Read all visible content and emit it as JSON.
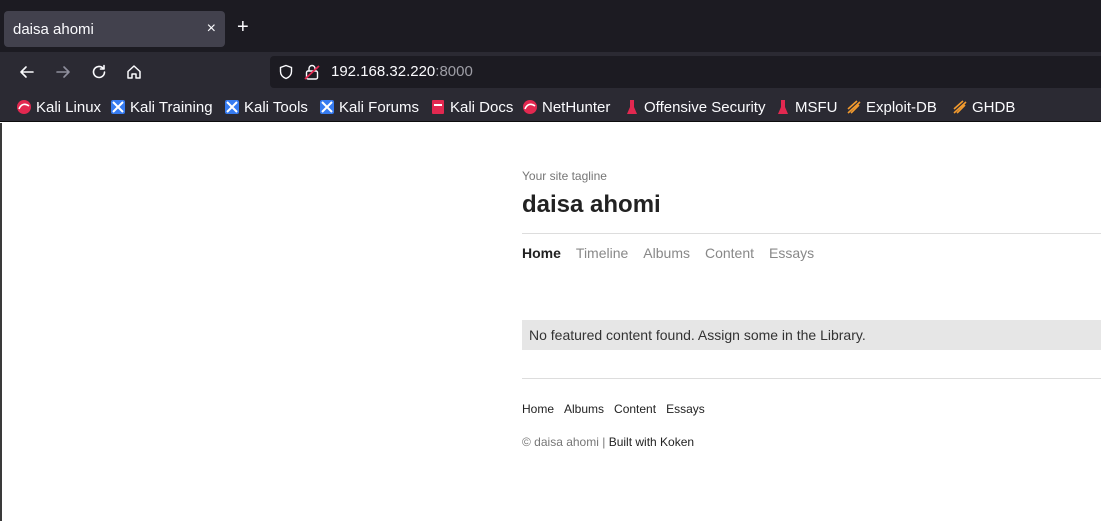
{
  "browser": {
    "tab": {
      "title": "daisa ahomi",
      "close_glyph": "×"
    },
    "new_tab_glyph": "+",
    "url": {
      "host": "192.168.32.220",
      "port": ":8000"
    },
    "bookmarks": [
      {
        "label": "Kali Linux",
        "icon": "kali-dragon-icon"
      },
      {
        "label": "Kali Training",
        "icon": "kali-training-icon"
      },
      {
        "label": "Kali Tools",
        "icon": "kali-tools-icon"
      },
      {
        "label": "Kali Forums",
        "icon": "kali-forums-icon"
      },
      {
        "label": "Kali Docs",
        "icon": "kali-docs-icon"
      },
      {
        "label": "NetHunter",
        "icon": "nethunter-icon"
      },
      {
        "label": "Offensive Security",
        "icon": "offsec-icon"
      },
      {
        "label": "MSFU",
        "icon": "msfu-icon"
      },
      {
        "label": "Exploit-DB",
        "icon": "exploit-db-icon"
      },
      {
        "label": "GHDB",
        "icon": "ghdb-icon"
      }
    ],
    "colors": {
      "tabbar": "#1c1b22",
      "toolbar": "#2b2a33",
      "text": "#fbfbfe"
    }
  },
  "site": {
    "tagline": "Your site tagline",
    "title": "daisa ahomi",
    "nav": [
      "Home",
      "Timeline",
      "Albums",
      "Content",
      "Essays"
    ],
    "active_nav": "Home",
    "notice": "No featured content found. Assign some in the Library.",
    "footer_nav": [
      "Home",
      "Albums",
      "Content",
      "Essays"
    ],
    "copyright": "© daisa ahomi |",
    "built_with": "Built with Koken"
  }
}
